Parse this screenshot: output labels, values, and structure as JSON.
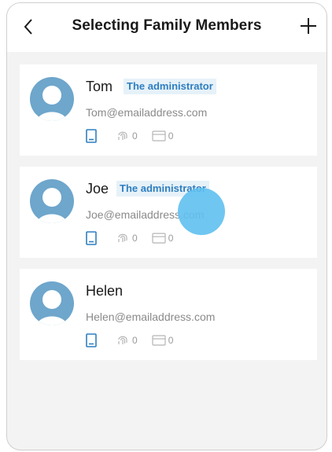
{
  "header": {
    "title": "Selecting Family Members",
    "back_icon": "chevron-left-icon",
    "add_icon": "plus-icon"
  },
  "colors": {
    "avatar": "#6ea6cc",
    "badge_text": "#2f7fc0",
    "badge_bg": "#e6f1f8",
    "phone_icon": "#2f7fc0",
    "touch_indicator": "#5fc0f0"
  },
  "members": [
    {
      "name": "Tom",
      "badge": "The administrator",
      "email": "Tom@emailaddress.com",
      "fingerprint_count": "0",
      "card_count": "0"
    },
    {
      "name": "Joe",
      "badge": "The administrator",
      "email": "Joe@emailaddress.com",
      "fingerprint_count": "0",
      "card_count": "0"
    },
    {
      "name": "Helen",
      "badge": "",
      "email": "Helen@emailaddress.com",
      "fingerprint_count": "0",
      "card_count": "0"
    }
  ]
}
